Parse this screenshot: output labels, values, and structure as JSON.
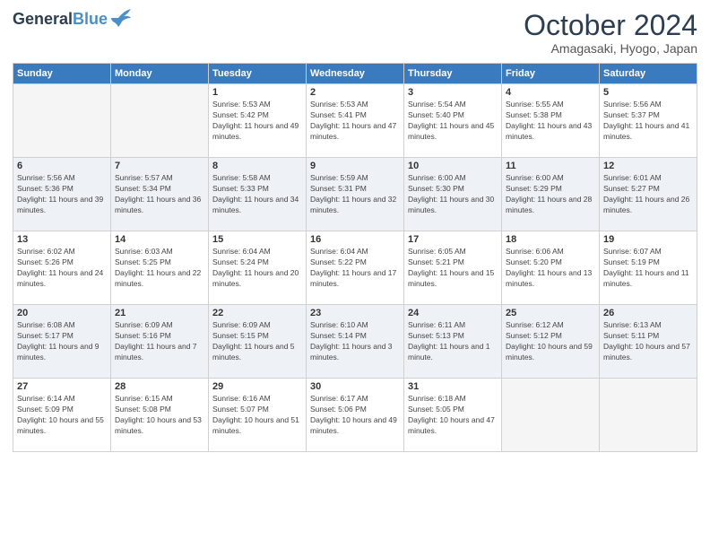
{
  "header": {
    "logo_general": "General",
    "logo_blue": "Blue",
    "month_title": "October 2024",
    "location": "Amagasaki, Hyogo, Japan"
  },
  "days_of_week": [
    "Sunday",
    "Monday",
    "Tuesday",
    "Wednesday",
    "Thursday",
    "Friday",
    "Saturday"
  ],
  "weeks": [
    [
      {
        "day": "",
        "empty": true
      },
      {
        "day": "",
        "empty": true
      },
      {
        "day": "1",
        "sunrise": "Sunrise: 5:53 AM",
        "sunset": "Sunset: 5:42 PM",
        "daylight": "Daylight: 11 hours and 49 minutes."
      },
      {
        "day": "2",
        "sunrise": "Sunrise: 5:53 AM",
        "sunset": "Sunset: 5:41 PM",
        "daylight": "Daylight: 11 hours and 47 minutes."
      },
      {
        "day": "3",
        "sunrise": "Sunrise: 5:54 AM",
        "sunset": "Sunset: 5:40 PM",
        "daylight": "Daylight: 11 hours and 45 minutes."
      },
      {
        "day": "4",
        "sunrise": "Sunrise: 5:55 AM",
        "sunset": "Sunset: 5:38 PM",
        "daylight": "Daylight: 11 hours and 43 minutes."
      },
      {
        "day": "5",
        "sunrise": "Sunrise: 5:56 AM",
        "sunset": "Sunset: 5:37 PM",
        "daylight": "Daylight: 11 hours and 41 minutes."
      }
    ],
    [
      {
        "day": "6",
        "sunrise": "Sunrise: 5:56 AM",
        "sunset": "Sunset: 5:36 PM",
        "daylight": "Daylight: 11 hours and 39 minutes."
      },
      {
        "day": "7",
        "sunrise": "Sunrise: 5:57 AM",
        "sunset": "Sunset: 5:34 PM",
        "daylight": "Daylight: 11 hours and 36 minutes."
      },
      {
        "day": "8",
        "sunrise": "Sunrise: 5:58 AM",
        "sunset": "Sunset: 5:33 PM",
        "daylight": "Daylight: 11 hours and 34 minutes."
      },
      {
        "day": "9",
        "sunrise": "Sunrise: 5:59 AM",
        "sunset": "Sunset: 5:31 PM",
        "daylight": "Daylight: 11 hours and 32 minutes."
      },
      {
        "day": "10",
        "sunrise": "Sunrise: 6:00 AM",
        "sunset": "Sunset: 5:30 PM",
        "daylight": "Daylight: 11 hours and 30 minutes."
      },
      {
        "day": "11",
        "sunrise": "Sunrise: 6:00 AM",
        "sunset": "Sunset: 5:29 PM",
        "daylight": "Daylight: 11 hours and 28 minutes."
      },
      {
        "day": "12",
        "sunrise": "Sunrise: 6:01 AM",
        "sunset": "Sunset: 5:27 PM",
        "daylight": "Daylight: 11 hours and 26 minutes."
      }
    ],
    [
      {
        "day": "13",
        "sunrise": "Sunrise: 6:02 AM",
        "sunset": "Sunset: 5:26 PM",
        "daylight": "Daylight: 11 hours and 24 minutes."
      },
      {
        "day": "14",
        "sunrise": "Sunrise: 6:03 AM",
        "sunset": "Sunset: 5:25 PM",
        "daylight": "Daylight: 11 hours and 22 minutes."
      },
      {
        "day": "15",
        "sunrise": "Sunrise: 6:04 AM",
        "sunset": "Sunset: 5:24 PM",
        "daylight": "Daylight: 11 hours and 20 minutes."
      },
      {
        "day": "16",
        "sunrise": "Sunrise: 6:04 AM",
        "sunset": "Sunset: 5:22 PM",
        "daylight": "Daylight: 11 hours and 17 minutes."
      },
      {
        "day": "17",
        "sunrise": "Sunrise: 6:05 AM",
        "sunset": "Sunset: 5:21 PM",
        "daylight": "Daylight: 11 hours and 15 minutes."
      },
      {
        "day": "18",
        "sunrise": "Sunrise: 6:06 AM",
        "sunset": "Sunset: 5:20 PM",
        "daylight": "Daylight: 11 hours and 13 minutes."
      },
      {
        "day": "19",
        "sunrise": "Sunrise: 6:07 AM",
        "sunset": "Sunset: 5:19 PM",
        "daylight": "Daylight: 11 hours and 11 minutes."
      }
    ],
    [
      {
        "day": "20",
        "sunrise": "Sunrise: 6:08 AM",
        "sunset": "Sunset: 5:17 PM",
        "daylight": "Daylight: 11 hours and 9 minutes."
      },
      {
        "day": "21",
        "sunrise": "Sunrise: 6:09 AM",
        "sunset": "Sunset: 5:16 PM",
        "daylight": "Daylight: 11 hours and 7 minutes."
      },
      {
        "day": "22",
        "sunrise": "Sunrise: 6:09 AM",
        "sunset": "Sunset: 5:15 PM",
        "daylight": "Daylight: 11 hours and 5 minutes."
      },
      {
        "day": "23",
        "sunrise": "Sunrise: 6:10 AM",
        "sunset": "Sunset: 5:14 PM",
        "daylight": "Daylight: 11 hours and 3 minutes."
      },
      {
        "day": "24",
        "sunrise": "Sunrise: 6:11 AM",
        "sunset": "Sunset: 5:13 PM",
        "daylight": "Daylight: 11 hours and 1 minute."
      },
      {
        "day": "25",
        "sunrise": "Sunrise: 6:12 AM",
        "sunset": "Sunset: 5:12 PM",
        "daylight": "Daylight: 10 hours and 59 minutes."
      },
      {
        "day": "26",
        "sunrise": "Sunrise: 6:13 AM",
        "sunset": "Sunset: 5:11 PM",
        "daylight": "Daylight: 10 hours and 57 minutes."
      }
    ],
    [
      {
        "day": "27",
        "sunrise": "Sunrise: 6:14 AM",
        "sunset": "Sunset: 5:09 PM",
        "daylight": "Daylight: 10 hours and 55 minutes."
      },
      {
        "day": "28",
        "sunrise": "Sunrise: 6:15 AM",
        "sunset": "Sunset: 5:08 PM",
        "daylight": "Daylight: 10 hours and 53 minutes."
      },
      {
        "day": "29",
        "sunrise": "Sunrise: 6:16 AM",
        "sunset": "Sunset: 5:07 PM",
        "daylight": "Daylight: 10 hours and 51 minutes."
      },
      {
        "day": "30",
        "sunrise": "Sunrise: 6:17 AM",
        "sunset": "Sunset: 5:06 PM",
        "daylight": "Daylight: 10 hours and 49 minutes."
      },
      {
        "day": "31",
        "sunrise": "Sunrise: 6:18 AM",
        "sunset": "Sunset: 5:05 PM",
        "daylight": "Daylight: 10 hours and 47 minutes."
      },
      {
        "day": "",
        "empty": true
      },
      {
        "day": "",
        "empty": true
      }
    ]
  ]
}
